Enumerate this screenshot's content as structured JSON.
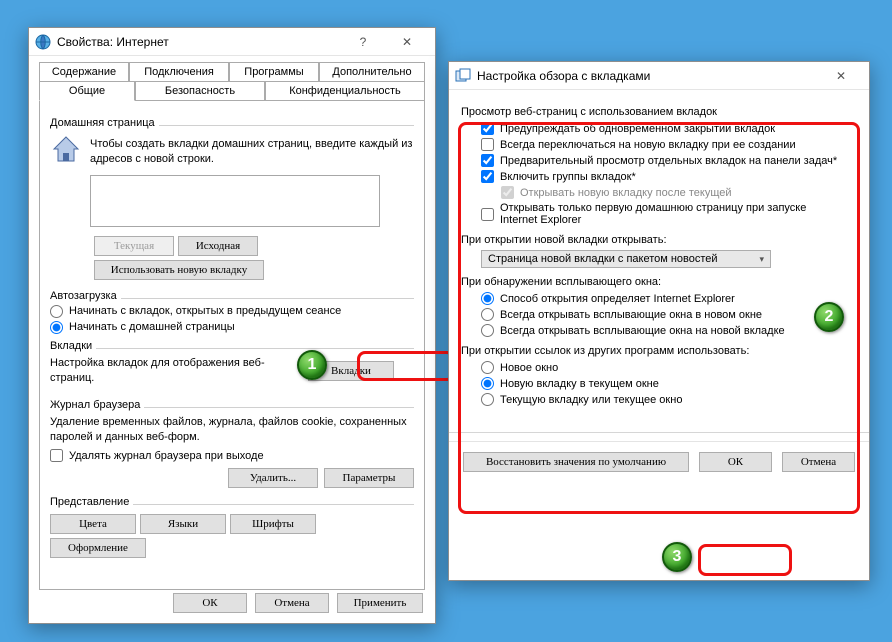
{
  "win1": {
    "title": "Свойства: Интернет",
    "tabs_back": [
      "Содержание",
      "Подключения",
      "Программы",
      "Дополнительно"
    ],
    "tabs_front": [
      "Общие",
      "Безопасность",
      "Конфиденциальность"
    ],
    "home": {
      "section": "Домашняя страница",
      "hint": "Чтобы создать вкладки домашних страниц, введите каждый из адресов с новой строки.",
      "addresses": "",
      "btn_current": "Текущая",
      "btn_default": "Исходная",
      "btn_newtab": "Использовать новую вкладку"
    },
    "startup": {
      "section": "Автозагрузка",
      "r1": "Начинать с вкладок, открытых в предыдущем сеансе",
      "r2": "Начинать с домашней страницы"
    },
    "tabsec": {
      "section": "Вкладки",
      "text": "Настройка вкладок для отображения веб-страниц.",
      "btn": "Вкладки"
    },
    "history": {
      "section": "Журнал браузера",
      "text": "Удаление временных файлов, журнала, файлов cookie, сохраненных паролей и данных веб-форм.",
      "chk": "Удалять журнал браузера при выходе",
      "btn_del": "Удалить...",
      "btn_set": "Параметры"
    },
    "appearance": {
      "section": "Представление",
      "b1": "Цвета",
      "b2": "Языки",
      "b3": "Шрифты",
      "b4": "Оформление"
    },
    "footer": {
      "ok": "ОК",
      "cancel": "Отмена",
      "apply": "Применить"
    }
  },
  "win2": {
    "title": "Настройка обзора с вкладками",
    "g1": {
      "heading": "Просмотр веб-страниц с использованием вкладок",
      "c1": "Предупреждать об одновременном закрытии вкладок",
      "c2": "Всегда переключаться на новую вкладку при ее создании",
      "c3": "Предварительный просмотр отдельных вкладок на панели задач*",
      "c4": "Включить группы вкладок*",
      "c5": "Открывать новую вкладку после текущей",
      "c6": "Открывать только первую домашнюю страницу при запуске Internet Explorer"
    },
    "g2": {
      "heading": "При открытии новой вкладки открывать:",
      "dropdown": "Страница новой вкладки с пакетом новостей"
    },
    "g3": {
      "heading": "При обнаружении всплывающего окна:",
      "r1": "Способ открытия определяет Internet Explorer",
      "r2": "Всегда открывать всплывающие окна в новом окне",
      "r3": "Всегда открывать всплывающие окна на новой вкладке"
    },
    "g4": {
      "heading": "При открытии ссылок из других программ использовать:",
      "r1": "Новое окно",
      "r2": "Новую вкладку в текущем окне",
      "r3": "Текущую вкладку или текущее окно"
    },
    "footer": {
      "restore": "Восстановить значения по умолчанию",
      "ok": "ОК",
      "cancel": "Отмена"
    }
  },
  "markers": {
    "m1": "1",
    "m2": "2",
    "m3": "3"
  }
}
